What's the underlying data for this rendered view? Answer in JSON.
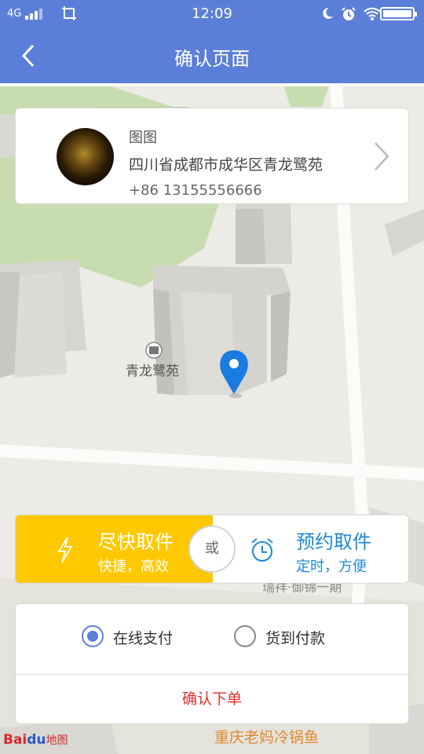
{
  "status_bar": {
    "network": "4G",
    "time": "12:09"
  },
  "header": {
    "title": "确认页面"
  },
  "address_card": {
    "name": "图图",
    "address": "四川省成都市成华区青龙鹭苑",
    "phone": "+86  13155556666"
  },
  "map": {
    "poi_label": "青龙鹭苑",
    "road_label": "瑞祥·御锦一期",
    "shop_label": "重庆老妈冷锅鱼",
    "logo_bai": "Bai",
    "logo_du": "du",
    "logo_map": "地图"
  },
  "pickup": {
    "asap_title": "尽快取件",
    "asap_subtitle": "快捷，高效",
    "or_label": "或",
    "scheduled_title": "预约取件",
    "scheduled_subtitle": "定时，方便",
    "selected": "asap"
  },
  "payment": {
    "options": [
      {
        "label": "在线支付",
        "selected": true
      },
      {
        "label": "货到付款",
        "selected": false
      }
    ],
    "confirm_label": "确认下单"
  },
  "colors": {
    "header_blue": "#5b7fd8",
    "asap_yellow": "#ffc800",
    "scheduled_blue": "#1d8ad8",
    "confirm_red": "#e03030",
    "marker_blue": "#1a7be0"
  }
}
